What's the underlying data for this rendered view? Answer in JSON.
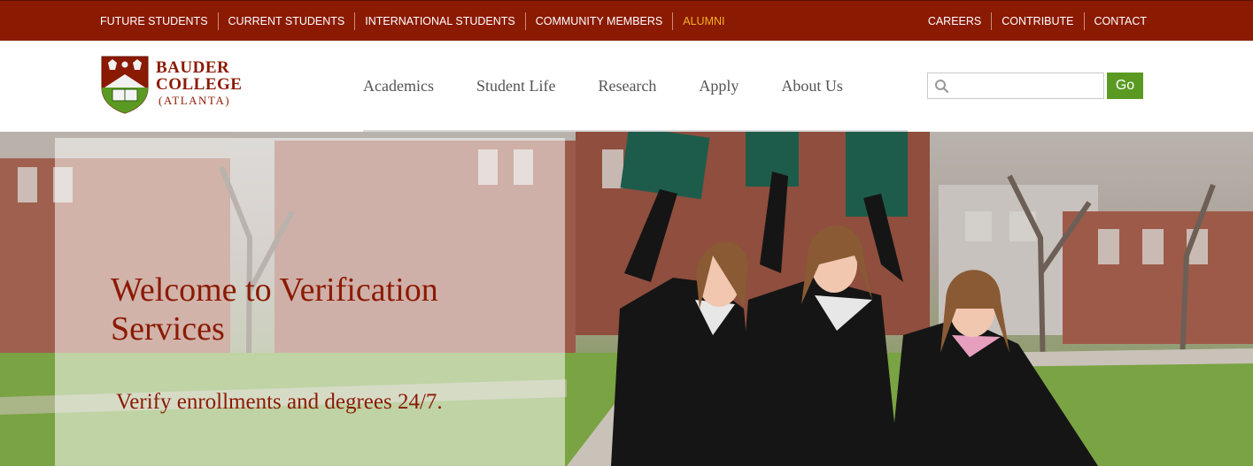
{
  "utility_nav": {
    "left": [
      "FUTURE STUDENTS",
      "CURRENT STUDENTS",
      "INTERNATIONAL STUDENTS",
      "COMMUNITY MEMBERS",
      "ALUMNI"
    ],
    "right": [
      "CAREERS",
      "CONTRIBUTE",
      "CONTACT"
    ],
    "active": "ALUMNI",
    "colors": {
      "bar": "#8b1a03",
      "active": "#f5b021"
    }
  },
  "logo": {
    "line1": "BAUDER",
    "line2": "COLLEGE",
    "line3": "(ATLANTA)",
    "icon": "college-crest-icon"
  },
  "main_nav": [
    "Academics",
    "Student Life",
    "Research",
    "Apply",
    "About Us"
  ],
  "search": {
    "value": "",
    "placeholder": "",
    "button_label": "Go",
    "icon": "search-icon",
    "button_color": "#5b9a22"
  },
  "hero": {
    "title": "Welcome to Verification Services",
    "subtitle": "Verify enrollments and degrees 24/7.",
    "title_color": "#8b1a03",
    "image": "graduates-celebrating-photo"
  }
}
